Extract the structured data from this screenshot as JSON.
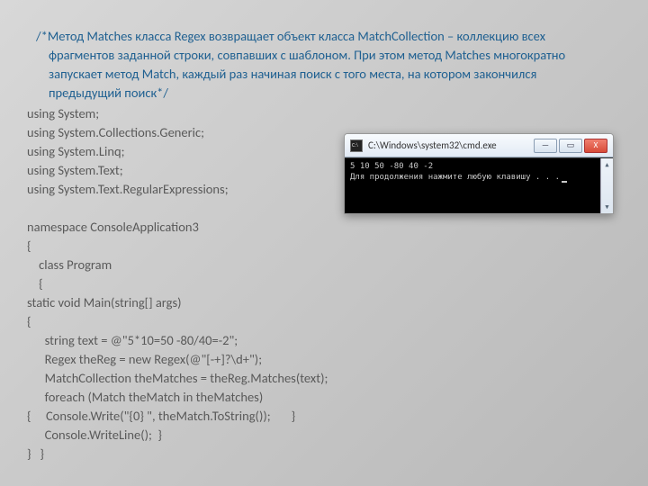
{
  "comment": "/*Метод Matches класса Regex возвращает объект класса MatchCollection – коллекцию всех фрагментов заданной строки, совпавших с шаблоном. При этом метод Matches многократно запускает метод Match, каждый раз начиная поиск с того места, на котором закончился предыдущий поиск*/",
  "code": {
    "l1": "using System;",
    "l2": "using System.Collections.Generic;",
    "l3": "using System.Linq;",
    "l4": "using System.Text;",
    "l5": "using System.Text.RegularExpressions;",
    "l6": " ",
    "l7": "namespace ConsoleApplication3",
    "l8": "{",
    "l9": "    class Program",
    "l10": "    {",
    "l11": "static void Main(string[] args)",
    "l12": "{",
    "l13": "      string text = @\"5*10=50 -80/40=-2\";",
    "l14": "      Regex theReg = new Regex(@\"[-+]?\\d+\");",
    "l15": "      MatchCollection theMatches = theReg.Matches(text);",
    "l16": "      foreach (Match theMatch in theMatches)",
    "l17": "{     Console.Write(\"{0} \", theMatch.ToString());       }",
    "l18": "      Console.WriteLine();  }",
    "l19": "}   }"
  },
  "console": {
    "title": "C:\\Windows\\system32\\cmd.exe",
    "out1": "5 10 50 -80 40 -2",
    "out2": "Для продолжения нажмите любую клавишу . . .",
    "btn_min": "—",
    "btn_max": "▭",
    "btn_close": "X",
    "arrow_up": "▲",
    "arrow_down": "▼"
  }
}
